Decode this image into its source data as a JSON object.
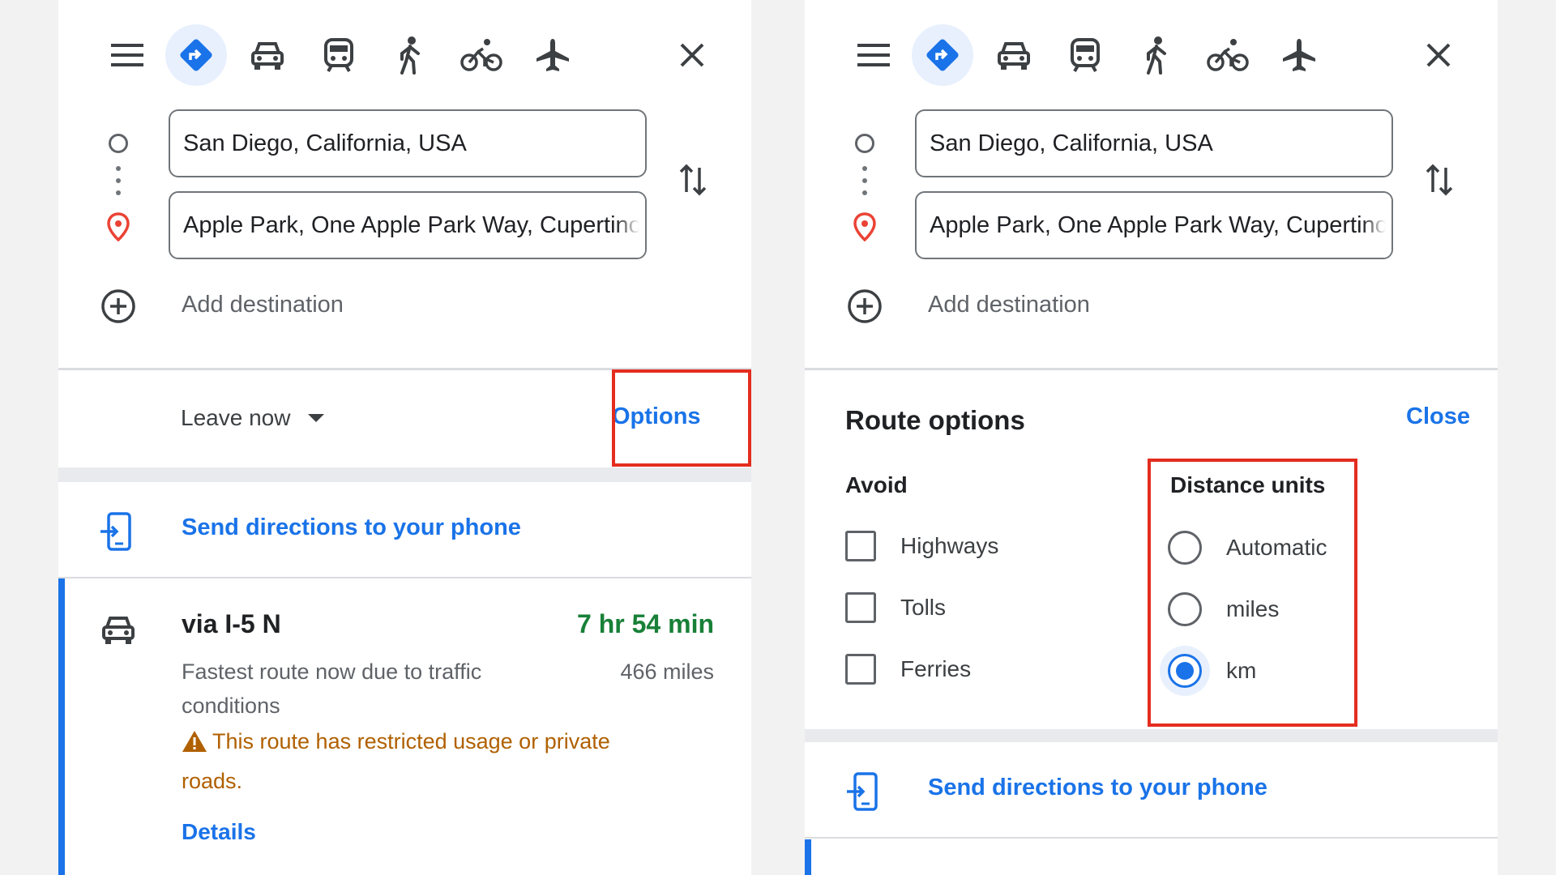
{
  "colors": {
    "accent": "#1a73e8",
    "highlight": "#e42d1f",
    "duration": "#188038",
    "warning": "#b06000"
  },
  "travel_modes": [
    "menu-icon",
    "best-route-icon",
    "car-icon",
    "transit-icon",
    "walk-icon",
    "bike-icon",
    "flight-icon",
    "close-icon"
  ],
  "left": {
    "origin": "San Diego, California, USA",
    "destination": "Apple Park, One Apple Park Way, Cupertino",
    "add_destination": "Add destination",
    "leave_now": "Leave now",
    "options": "Options",
    "send_to_phone": "Send directions to your phone",
    "route": {
      "via": "via I-5 N",
      "duration": "7 hr 54 min",
      "description": "Fastest route now due to traffic conditions",
      "distance": "466 miles",
      "warning": "This route has restricted usage or private roads.",
      "details": "Details"
    }
  },
  "right": {
    "origin": "San Diego, California, USA",
    "destination": "Apple Park, One Apple Park Way, Cupertino",
    "add_destination": "Add destination",
    "route_options_title": "Route options",
    "close": "Close",
    "avoid": {
      "title": "Avoid",
      "items": [
        {
          "label": "Highways",
          "checked": false
        },
        {
          "label": "Tolls",
          "checked": false
        },
        {
          "label": "Ferries",
          "checked": false
        }
      ]
    },
    "distance_units": {
      "title": "Distance units",
      "options": [
        "Automatic",
        "miles",
        "km"
      ],
      "selected": "km"
    },
    "send_to_phone": "Send directions to your phone"
  }
}
